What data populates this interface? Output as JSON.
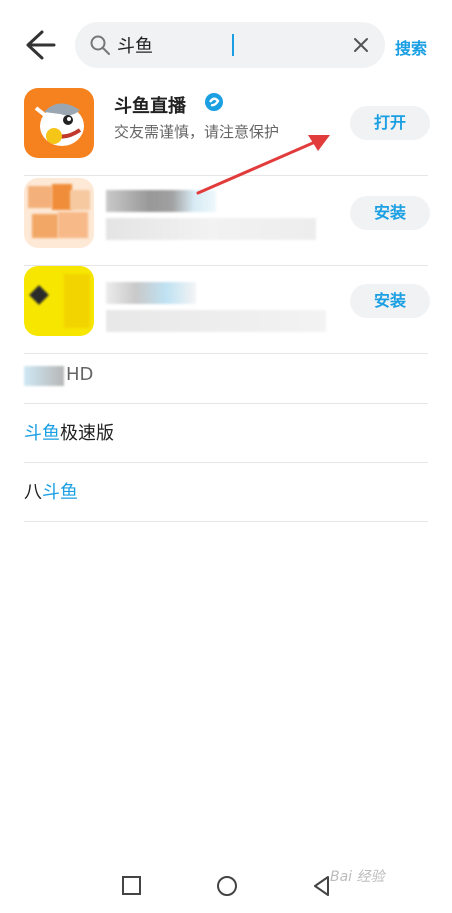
{
  "search": {
    "query": "斗鱼",
    "button_label": "搜索"
  },
  "results": [
    {
      "name": "斗鱼直播",
      "desc": "交友需谨慎，请注意保护",
      "action": "打开",
      "verified": true
    },
    {
      "name": "",
      "desc": "",
      "action": "安装",
      "verified": false
    },
    {
      "name": "",
      "desc": "",
      "action": "安装",
      "verified": false
    }
  ],
  "partial_item": "HD",
  "suggestions": [
    {
      "highlight": "斗鱼",
      "rest": "极速版",
      "prefix": ""
    },
    {
      "highlight": "斗鱼",
      "rest": "",
      "prefix": "八"
    }
  ],
  "watermark": "Bai 经验",
  "colors": {
    "accent": "#1a9fe3",
    "douyu_orange": "#f6821f",
    "annotation_arrow": "#e23b3b"
  },
  "icons": [
    "back-arrow-icon",
    "search-icon",
    "clear-icon",
    "verified-icon",
    "square-nav-icon",
    "circle-nav-icon",
    "triangle-nav-icon"
  ]
}
